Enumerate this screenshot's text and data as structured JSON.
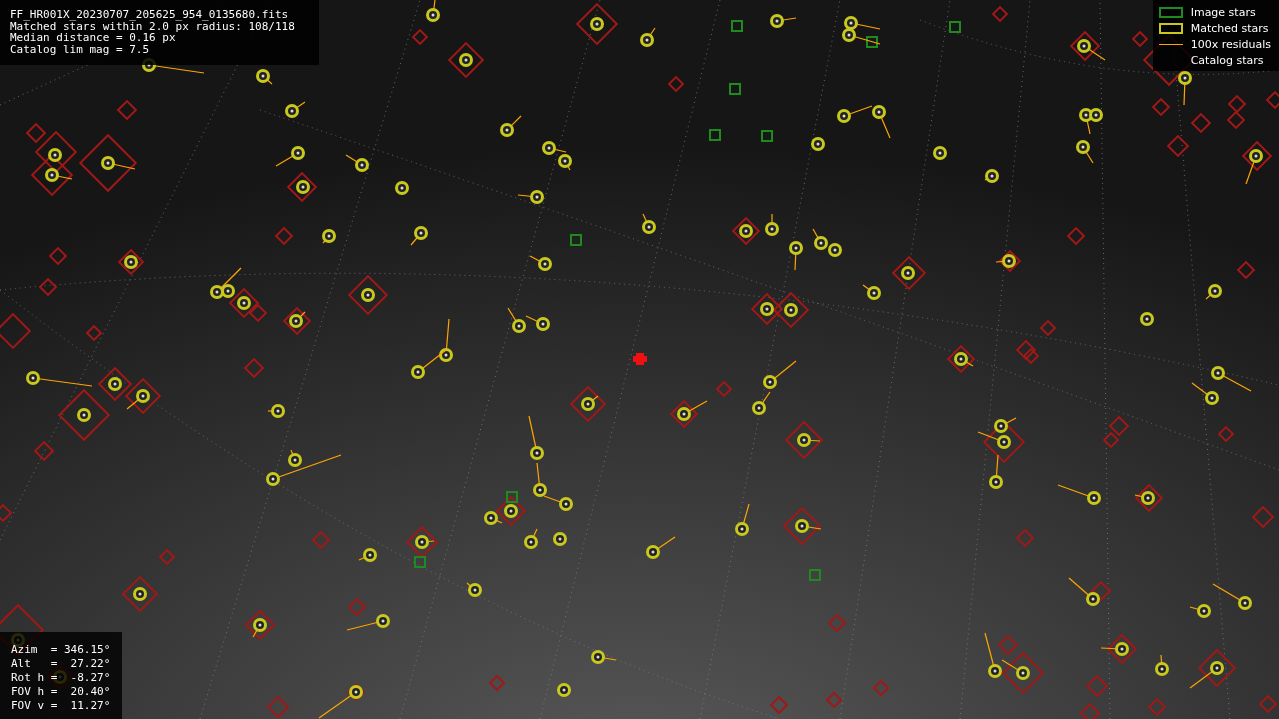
{
  "info": {
    "lines": [
      "FF_HR001X_20230707_205625_954_0135680.fits",
      "Matched stars within 2.0 px radius: 108/118",
      "Median distance = 0.16 px",
      "Catalog lim mag = 7.5"
    ]
  },
  "legend": [
    {
      "kind": "box",
      "color": "#1f8a1f",
      "label": "Image stars"
    },
    {
      "kind": "box",
      "color": "#c8c81e",
      "label": "Matched stars"
    },
    {
      "kind": "line",
      "color": "#ffa500",
      "label": "100x residuals"
    },
    {
      "kind": "none",
      "label": "Catalog stars"
    }
  ],
  "pointing": {
    "lines": [
      "Azim  = 346.15°",
      "Alt   =  27.22°",
      "Rot h =  -8.27°",
      "FOV h =  20.40°",
      "FOV v =  11.27°"
    ]
  }
}
